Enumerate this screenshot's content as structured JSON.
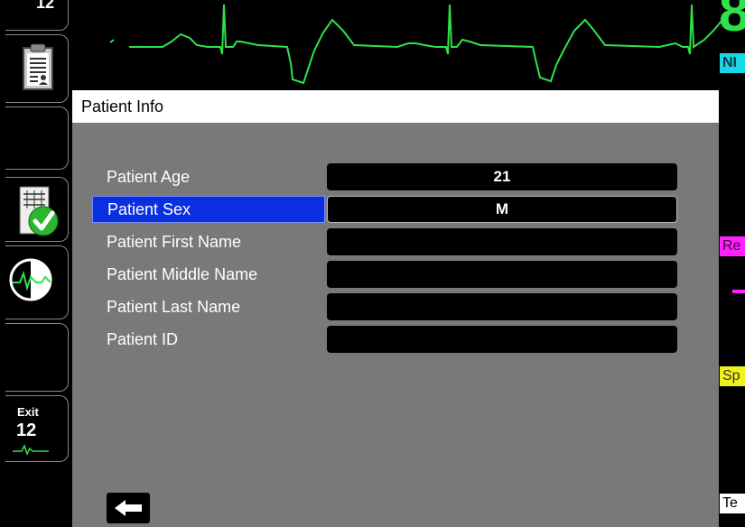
{
  "monitor": {
    "heart_rate_partial": "8",
    "tags": {
      "nibp": "NI",
      "resp": "Re",
      "spo2": "Sp",
      "temp": "Te"
    }
  },
  "softkeys": {
    "top_partial": "12",
    "exit_label": "Exit",
    "exit_number": "12",
    "icons": [
      "clipboard-icon",
      "schedule-check-icon",
      "waveform-icon",
      "twelve-lead-icon"
    ]
  },
  "dialog": {
    "title": "Patient Info",
    "fields": [
      {
        "label": "Patient Age",
        "value": "21",
        "selected": false
      },
      {
        "label": "Patient Sex",
        "value": "M",
        "selected": true
      },
      {
        "label": "Patient First Name",
        "value": "",
        "selected": false
      },
      {
        "label": "Patient Middle Name",
        "value": "",
        "selected": false
      },
      {
        "label": "Patient Last Name",
        "value": "",
        "selected": false
      },
      {
        "label": "Patient ID",
        "value": "",
        "selected": false
      }
    ],
    "back_icon": "left-arrow-icon"
  },
  "colors": {
    "ecg": "#2ee34a",
    "selection": "#0a2fe0",
    "dialog_bg": "#797979",
    "nibp": "#19d7e8",
    "resp": "#ff22ff",
    "spo2": "#f2f21a"
  }
}
